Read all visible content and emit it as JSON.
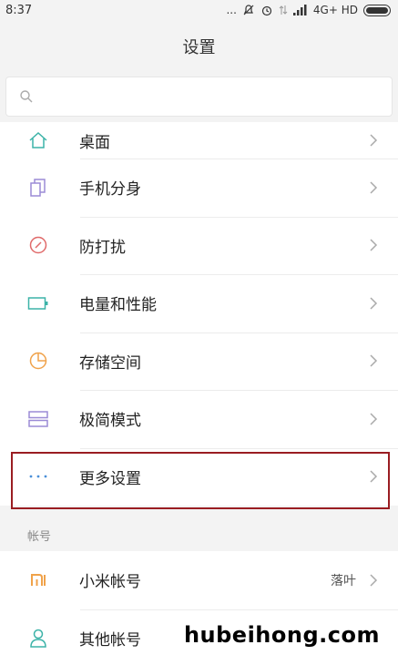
{
  "status_bar": {
    "time": "8:37",
    "dots": "...",
    "network": "4G+ HD"
  },
  "header": {
    "title": "设置"
  },
  "search": {
    "placeholder": ""
  },
  "settings_items": [
    {
      "label": "桌面",
      "icon": "home-icon"
    },
    {
      "label": "手机分身",
      "icon": "dual-screen-icon"
    },
    {
      "label": "防打扰",
      "icon": "do-not-disturb-icon"
    },
    {
      "label": "电量和性能",
      "icon": "battery-icon"
    },
    {
      "label": "存储空间",
      "icon": "storage-pie-icon"
    },
    {
      "label": "极简模式",
      "icon": "simple-mode-icon"
    },
    {
      "label": "更多设置",
      "icon": "more-dots-icon"
    }
  ],
  "account_section": {
    "header": "帐号",
    "items": [
      {
        "label": "小米帐号",
        "value": "落叶",
        "icon": "mi-logo-icon"
      },
      {
        "label": "其他帐号",
        "icon": "person-icon"
      }
    ]
  },
  "watermark": "hubeihong.com",
  "colors": {
    "accent_teal": "#3cb3a8",
    "highlight_border": "#9a1d22",
    "icon_orange": "#f0a24a",
    "icon_purple": "#9b8bd6",
    "icon_red": "#e06a6a",
    "icon_blue": "#4a8fd8"
  }
}
